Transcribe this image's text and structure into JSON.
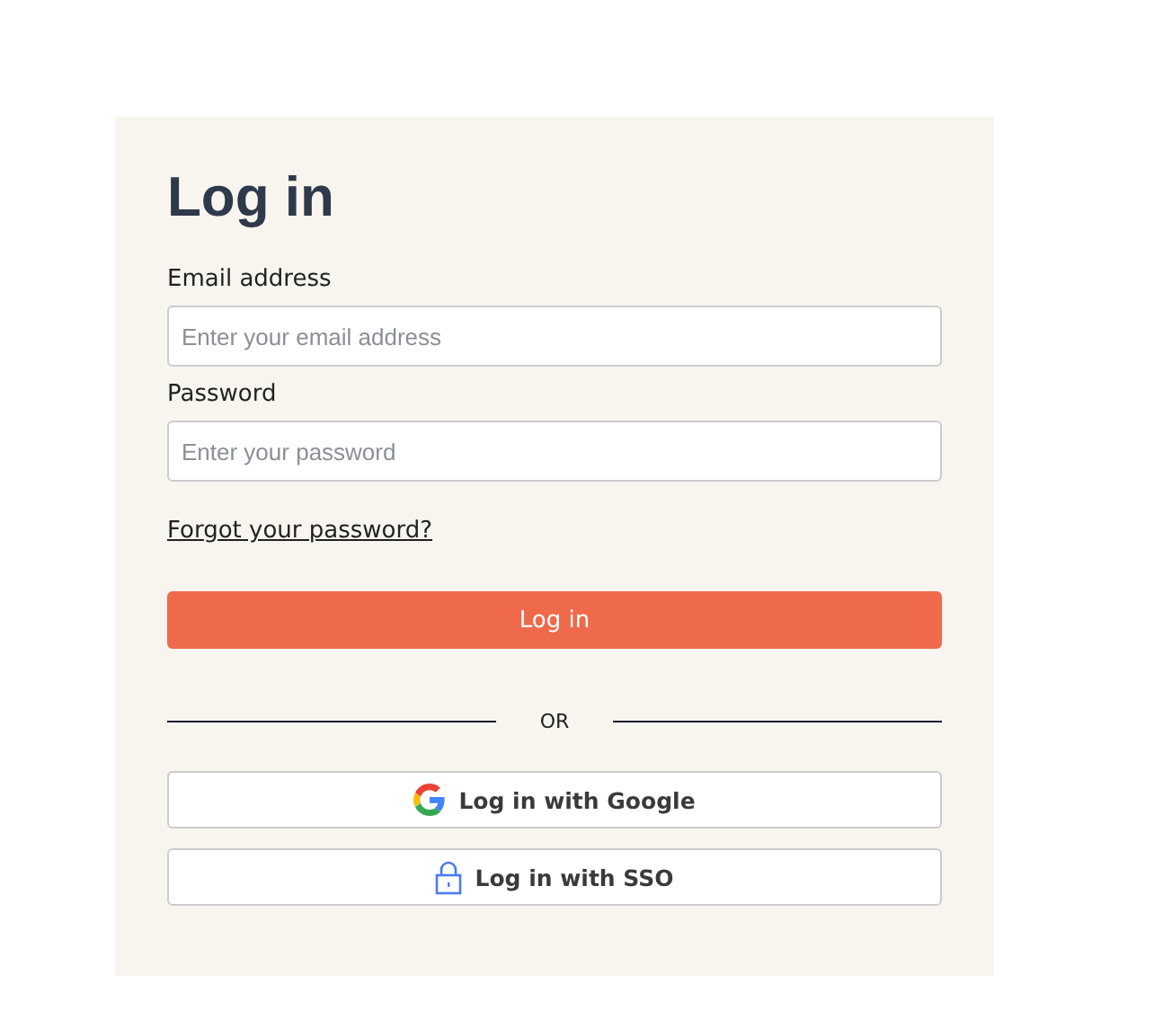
{
  "title": "Log in",
  "fields": [
    {
      "label": "Email address",
      "placeholder": "Enter your email address"
    },
    {
      "label": "Password",
      "placeholder": "Enter your password"
    }
  ],
  "forgot_link": "Forgot your password?",
  "submit_button": "Log in",
  "divider": "OR",
  "providers": [
    {
      "kind": "google",
      "label": "Log in with Google"
    },
    {
      "kind": "sso",
      "label": "Log in with SSO"
    }
  ]
}
